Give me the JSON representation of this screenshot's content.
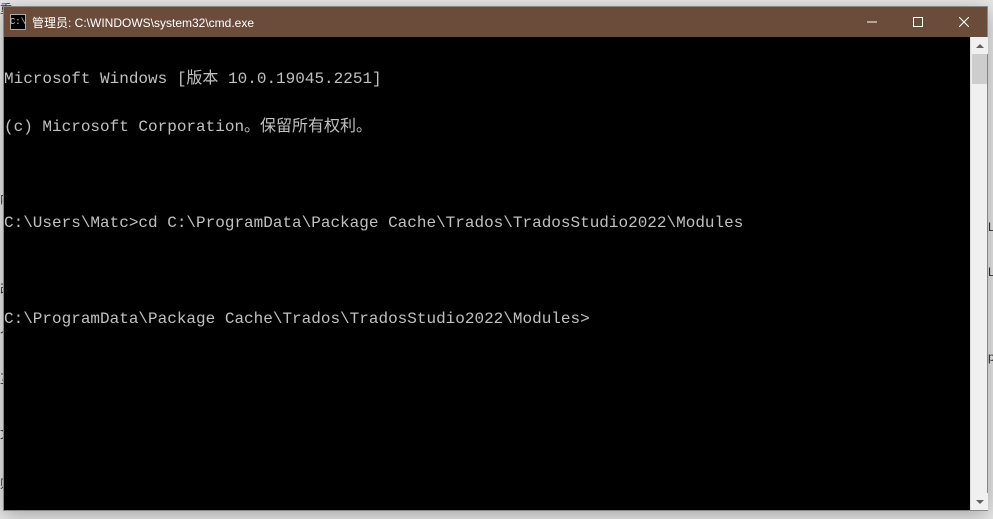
{
  "window": {
    "title": "管理员: C:\\WINDOWS\\system32\\cmd.exe",
    "icon_label": "C:\\"
  },
  "terminal": {
    "lines": [
      "Microsoft Windows [版本 10.0.19045.2251]",
      "(c) Microsoft Corporation。保留所有权利。",
      "",
      "C:\\Users\\Matc>cd C:\\ProgramData\\Package Cache\\Trados\\TradosStudio2022\\Modules",
      "",
      "C:\\ProgramData\\Package Cache\\Trados\\TradosStudio2022\\Modules>"
    ]
  },
  "bg": {
    "c1": "重",
    "c2": "内",
    "c3": "改",
    "c4": "个",
    "c5": "互",
    "c6": "文",
    "c7": "则",
    "c8": "L",
    "c9": "L",
    "c10": "p"
  },
  "controls": {
    "minimize": "─",
    "maximize": "☐",
    "close": "✕",
    "scroll_up": "▴",
    "scroll_down": "▾"
  }
}
